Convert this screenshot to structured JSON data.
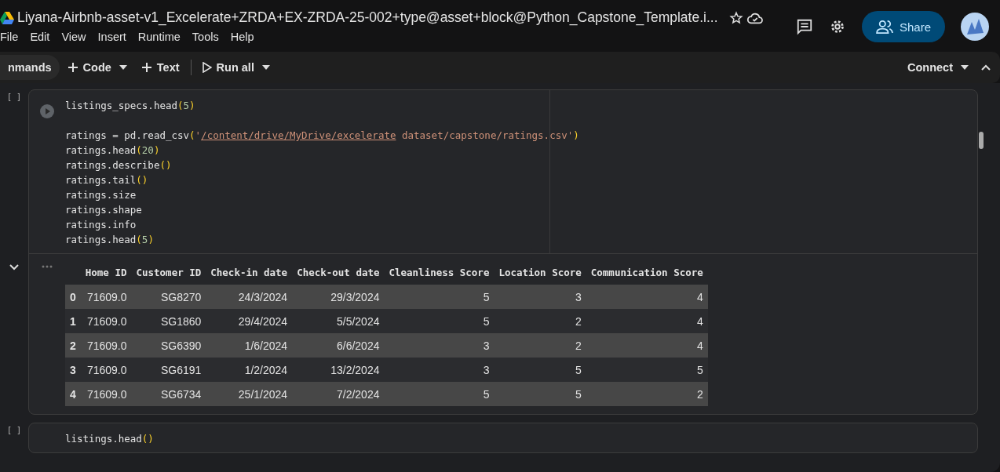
{
  "window": {
    "title": "Liyana-Airbnb-asset-v1_Excelerate+ZRDA+EX-ZRDA-25-002+type@asset+block@Python_Capstone_Template.i..."
  },
  "menu": [
    "File",
    "Edit",
    "View",
    "Insert",
    "Runtime",
    "Tools",
    "Help"
  ],
  "header_actions": {
    "share": "Share"
  },
  "toolbar": {
    "commands": "nmands",
    "add_code": "Code",
    "add_text": "Text",
    "run_all": "Run all",
    "connect": "Connect"
  },
  "cells": [
    {
      "exec_count": "[ ]",
      "code": [
        [
          [
            {
              "text": "listings_specs.head",
              "kind": "plain"
            },
            {
              "text": "(",
              "kind": "paren"
            },
            {
              "text": "5",
              "kind": "number"
            },
            {
              "text": ")",
              "kind": "paren"
            }
          ]
        ],
        [
          [
            {
              "text": "ratings = pd.read_csv",
              "kind": "plain"
            },
            {
              "text": "(",
              "kind": "paren"
            },
            {
              "text": "'",
              "kind": "string"
            },
            {
              "text": "/content/drive/MyDrive/excelerate",
              "kind": "link"
            },
            {
              "text": " dataset/capstone/ratings.csv'",
              "kind": "string"
            },
            {
              "text": ")",
              "kind": "paren"
            }
          ],
          [
            {
              "text": "ratings.head",
              "kind": "plain"
            },
            {
              "text": "(",
              "kind": "paren"
            },
            {
              "text": "20",
              "kind": "number"
            },
            {
              "text": ")",
              "kind": "paren"
            }
          ],
          [
            {
              "text": "ratings.describe",
              "kind": "plain"
            },
            {
              "text": "()",
              "kind": "paren"
            }
          ],
          [
            {
              "text": "ratings.tail",
              "kind": "plain"
            },
            {
              "text": "()",
              "kind": "paren"
            }
          ],
          [
            {
              "text": "ratings.size",
              "kind": "plain"
            }
          ],
          [
            {
              "text": "ratings.shape",
              "kind": "plain"
            }
          ],
          [
            {
              "text": "ratings.info",
              "kind": "plain"
            }
          ],
          [
            {
              "text": "ratings.head",
              "kind": "plain"
            },
            {
              "text": "(",
              "kind": "paren"
            },
            {
              "text": "5",
              "kind": "number"
            },
            {
              "text": ")",
              "kind": "paren"
            }
          ]
        ]
      ],
      "output": {
        "columns": [
          "",
          "Home ID",
          "Customer ID",
          "Check-in date",
          "Check-out date",
          "Cleanliness Score",
          "Location Score",
          "Communication Score"
        ],
        "rows": [
          [
            "0",
            "71609.0",
            "SG8270",
            "24/3/2024",
            "29/3/2024",
            "5",
            "3",
            "4"
          ],
          [
            "1",
            "71609.0",
            "SG1860",
            "29/4/2024",
            "5/5/2024",
            "5",
            "2",
            "4"
          ],
          [
            "2",
            "71609.0",
            "SG6390",
            "1/6/2024",
            "6/6/2024",
            "3",
            "2",
            "4"
          ],
          [
            "3",
            "71609.0",
            "SG6191",
            "1/2/2024",
            "13/2/2024",
            "3",
            "5",
            "5"
          ],
          [
            "4",
            "71609.0",
            "SG6734",
            "25/1/2024",
            "7/2/2024",
            "5",
            "5",
            "2"
          ]
        ]
      }
    },
    {
      "exec_count": "[ ]",
      "code": [
        [
          [
            {
              "text": "listings.head",
              "kind": "plain"
            },
            {
              "text": "()",
              "kind": "paren"
            }
          ]
        ]
      ]
    }
  ]
}
